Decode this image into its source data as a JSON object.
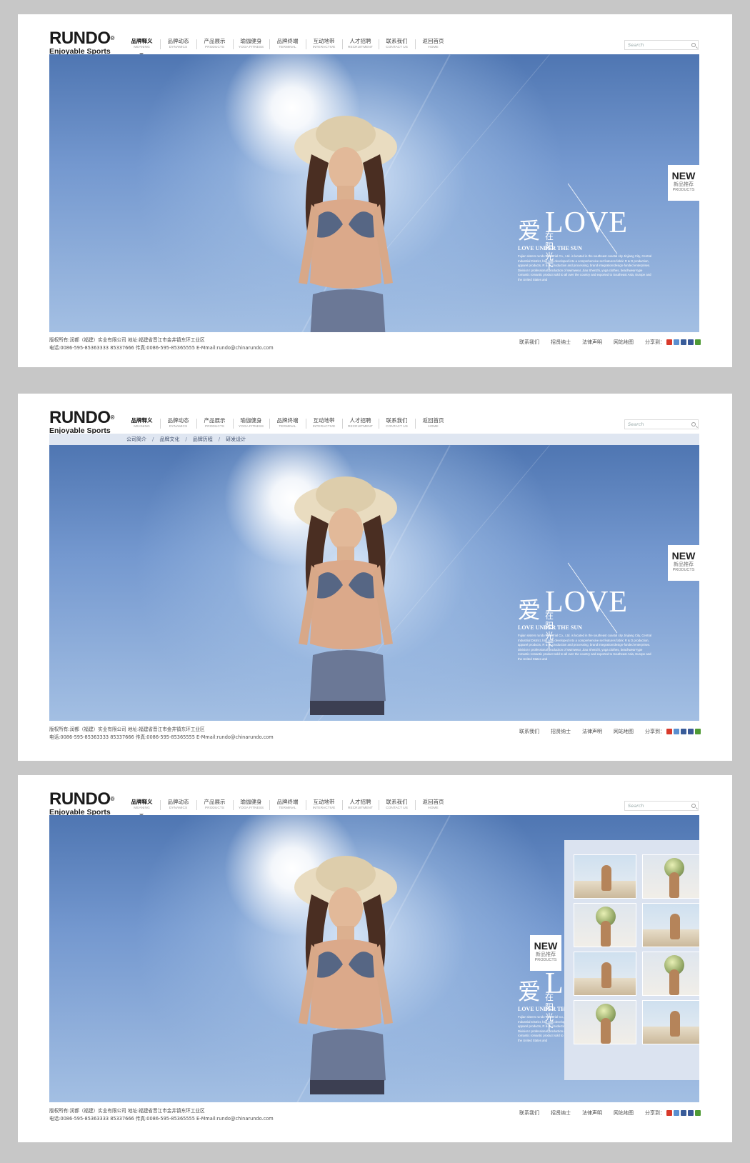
{
  "brand": {
    "name": "RUNDO",
    "mark": "®",
    "slogan": "Enjoyable Sports"
  },
  "nav": [
    {
      "zh": "品牌释义",
      "en": "MEANING",
      "active": true
    },
    {
      "zh": "品牌动态",
      "en": "DYNAMICS"
    },
    {
      "zh": "产品展示",
      "en": "PRODUCTS"
    },
    {
      "zh": "瑜伽健身",
      "en": "YOGA FITNESS"
    },
    {
      "zh": "品牌终端",
      "en": "TERMINAL"
    },
    {
      "zh": "互动地带",
      "en": "INTERACTIVE"
    },
    {
      "zh": "人才招聘",
      "en": "RECRUITMENT"
    },
    {
      "zh": "联系我们",
      "en": "CONTACT US"
    },
    {
      "zh": "返回首页",
      "en": "HOME"
    }
  ],
  "search": {
    "placeholder": "Search"
  },
  "subnav": [
    "公司简介",
    "品牌文化",
    "品牌历程",
    "研发设计"
  ],
  "subnav_sep": "/",
  "headline": {
    "zh_big": "爱",
    "love": "LOVE",
    "zh_sub": "在阳光下",
    "en_sub": "LOVE UNDER THE SUN",
    "desc": "Fujian sisters rundo Industrial Co., Ltd. is located in the southeast coastal city Jinjiang City, Central Industrial District, has now developed into a comprehensive set features fabric R & D production, apparel products, R & D, production and processing, brand integration/design-funded enterprises. Division I professional production of swimwear, Jiao Shenzhi, yoga clothes, beachwear-type romantic romantic product sold to all over the country and exported to Southeast Asia, Europe and the United States and"
  },
  "new_badge": {
    "title": "NEW",
    "zh": "新品推荐",
    "en": "PRODUCTS"
  },
  "footer": {
    "line1": "版权所有:润都（福建）实业有限公司 地址:福建省晋江市金井镇东环工业区",
    "line2": "电话:0086-595-85363333 85337666 传真:0086-595-85365555 E-Mmail:rundo@chinarundo.com",
    "links": [
      "联系我们",
      "招贤纳士",
      "法律声明",
      "网站地图"
    ],
    "share_label": "分享到："
  },
  "share_icons": [
    {
      "name": "weibo-icon",
      "color": "#d83a2b"
    },
    {
      "name": "qq-icon",
      "color": "#5a8fd0"
    },
    {
      "name": "renren-icon",
      "color": "#395c99"
    },
    {
      "name": "facebook-icon",
      "color": "#3b5998"
    },
    {
      "name": "kaixin-icon",
      "color": "#4f9a34"
    }
  ],
  "colors": {
    "sky_top": "#4f76b2",
    "sky_bottom": "#a3bfe3",
    "accent_white": "#ffffff",
    "gallery_bg": "#dbe3f0"
  }
}
